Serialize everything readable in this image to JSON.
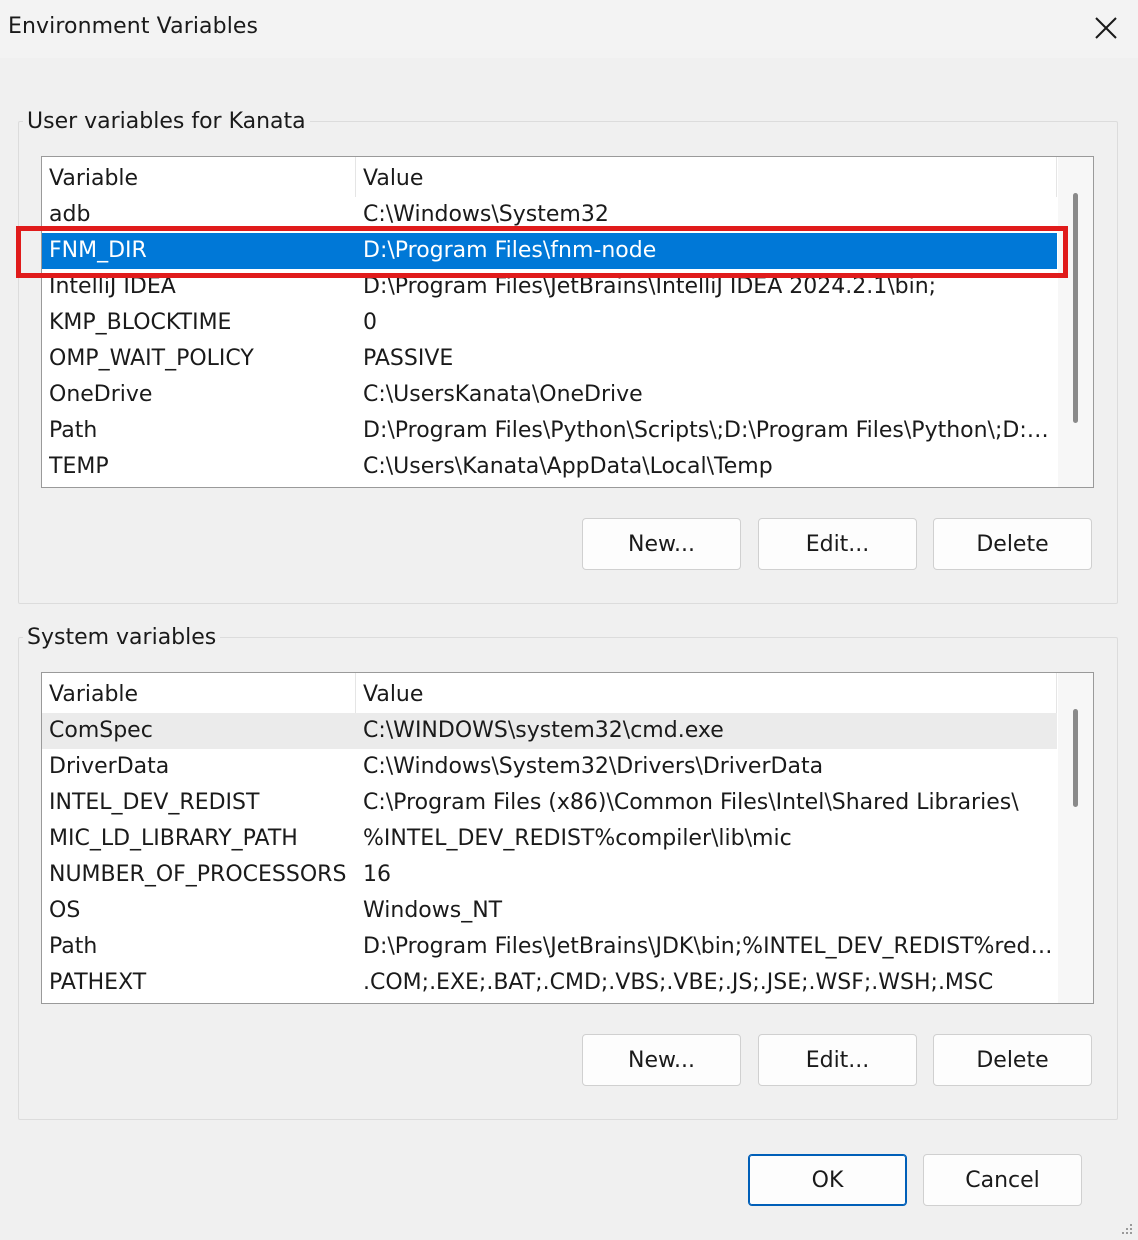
{
  "window": {
    "title": "Environment Variables"
  },
  "user_section": {
    "label": "User variables for Kanata",
    "columns": [
      "Variable",
      "Value"
    ],
    "rows": [
      {
        "name": "adb",
        "value": "C:\\Windows\\System32"
      },
      {
        "name": "FNM_DIR",
        "value": "D:\\Program Files\\fnm-node"
      },
      {
        "name": "IntelliJ IDEA",
        "value": "D:\\Program Files\\JetBrains\\IntelliJ IDEA 2024.2.1\\bin;"
      },
      {
        "name": "KMP_BLOCKTIME",
        "value": "0"
      },
      {
        "name": "OMP_WAIT_POLICY",
        "value": "PASSIVE"
      },
      {
        "name": "OneDrive",
        "value": "C:\\UsersKanata\\OneDrive"
      },
      {
        "name": "Path",
        "value": "D:\\Program Files\\Python\\Scripts\\;D:\\Program Files\\Python\\;D:\\P..."
      },
      {
        "name": "TEMP",
        "value": "C:\\Users\\Kanata\\AppData\\Local\\Temp"
      }
    ],
    "selected_row": "FNM_DIR",
    "buttons": {
      "new": "New...",
      "edit": "Edit...",
      "delete": "Delete"
    }
  },
  "system_section": {
    "label": "System variables",
    "columns": [
      "Variable",
      "Value"
    ],
    "rows": [
      {
        "name": "ComSpec",
        "value": "C:\\WINDOWS\\system32\\cmd.exe"
      },
      {
        "name": "DriverData",
        "value": "C:\\Windows\\System32\\Drivers\\DriverData"
      },
      {
        "name": "INTEL_DEV_REDIST",
        "value": "C:\\Program Files (x86)\\Common Files\\Intel\\Shared Libraries\\"
      },
      {
        "name": "MIC_LD_LIBRARY_PATH",
        "value": "%INTEL_DEV_REDIST%compiler\\lib\\mic"
      },
      {
        "name": "NUMBER_OF_PROCESSORS",
        "value": "16"
      },
      {
        "name": "OS",
        "value": "Windows_NT"
      },
      {
        "name": "Path",
        "value": "D:\\Program Files\\JetBrains\\JDK\\bin;%INTEL_DEV_REDIST%redist..."
      },
      {
        "name": "PATHEXT",
        "value": ".COM;.EXE;.BAT;.CMD;.VBS;.VBE;.JS;.JSE;.WSF;.WSH;.MSC"
      }
    ],
    "focused_row": "ComSpec",
    "buttons": {
      "new": "New...",
      "edit": "Edit...",
      "delete": "Delete"
    }
  },
  "footer": {
    "ok": "OK",
    "cancel": "Cancel"
  },
  "colors": {
    "selection": "#0078d7",
    "annotation": "#e01b1b",
    "primary_border": "#005fb8"
  },
  "icons": {
    "close": "close-icon",
    "resize": "resize-grip-icon"
  }
}
